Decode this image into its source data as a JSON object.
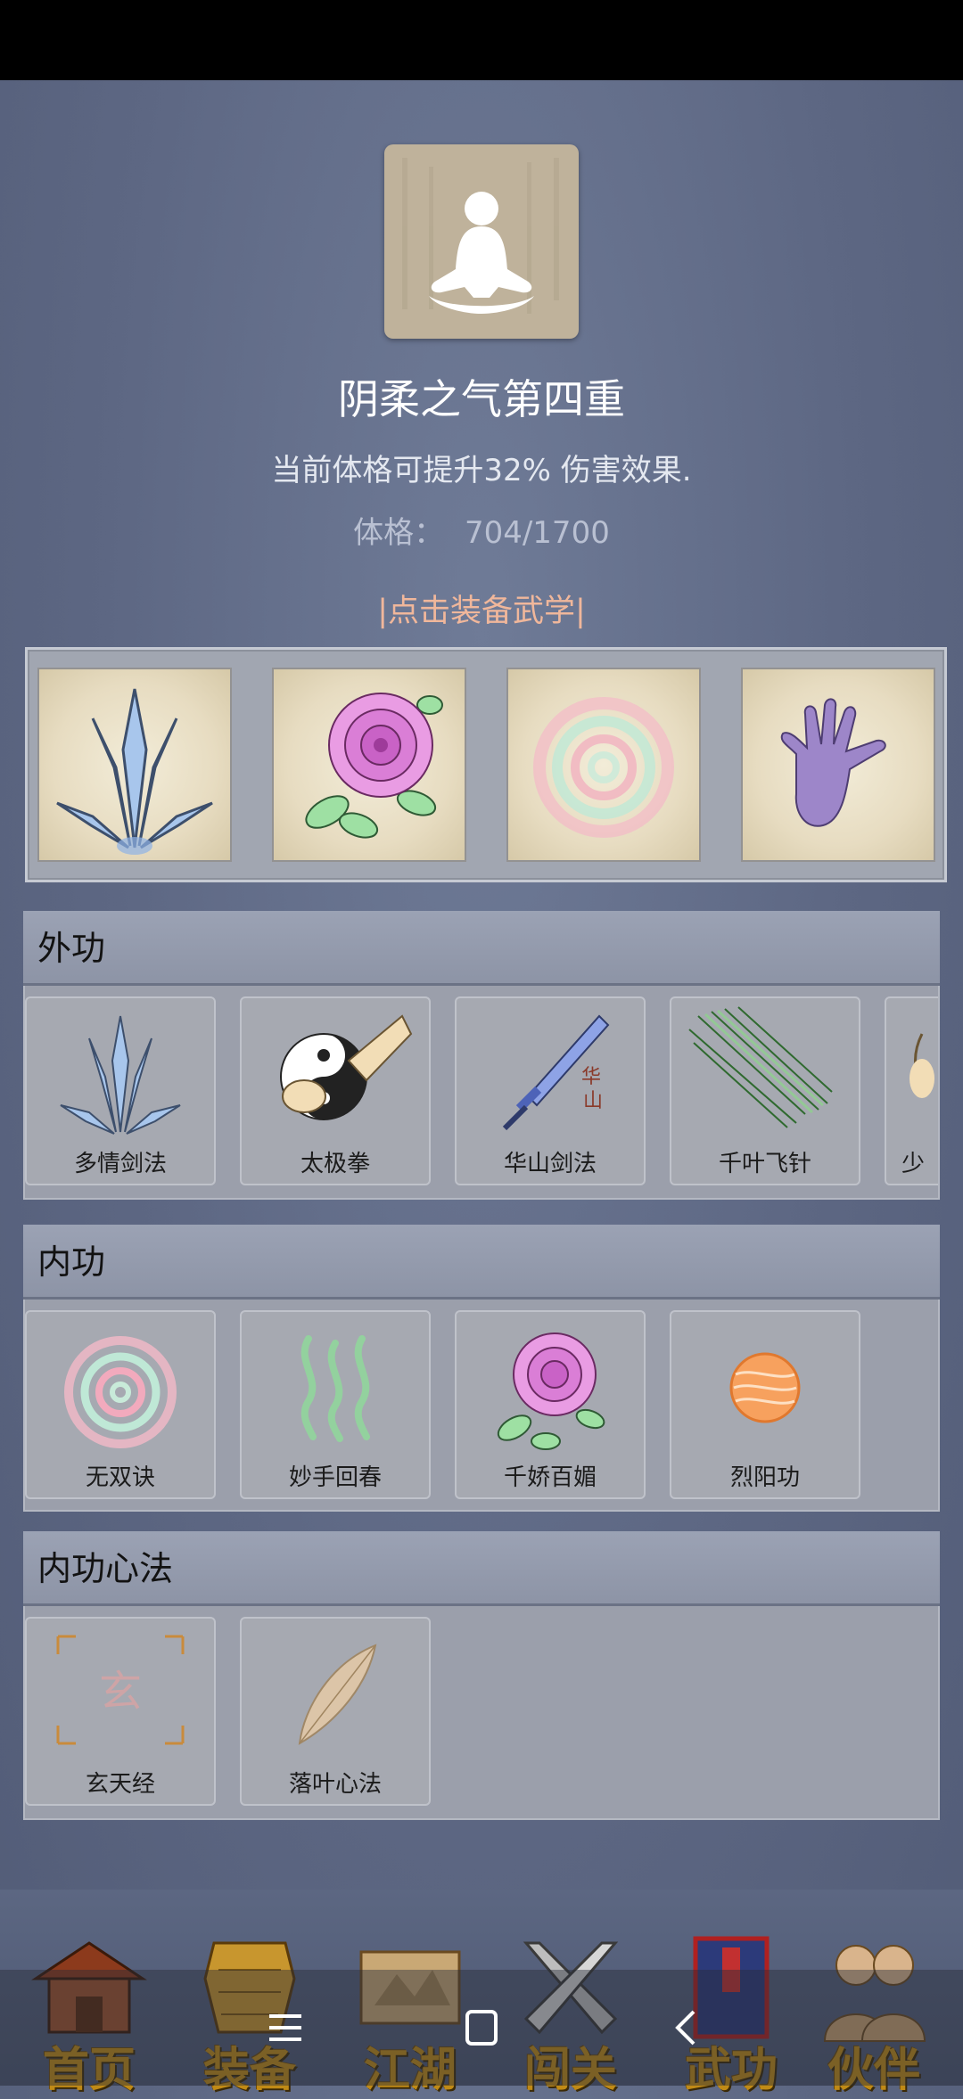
{
  "header": {
    "title": "阴柔之气第四重",
    "description": "当前体格可提升32% 伤害效果.",
    "stat_label": "体格：",
    "stat_value": "704/1700",
    "equip_link": "|点击装备武学|"
  },
  "equipped_slots": [
    {
      "icon": "blue-swords-icon"
    },
    {
      "icon": "pink-rose-icon"
    },
    {
      "icon": "spiral-icon"
    },
    {
      "icon": "purple-palm-icon"
    }
  ],
  "sections": {
    "waigong": {
      "title": "外功",
      "items": [
        {
          "name": "多情剑法",
          "icon": "blue-swords-icon"
        },
        {
          "name": "太极拳",
          "icon": "taiji-fist-icon"
        },
        {
          "name": "华山剑法",
          "icon": "huashan-sword-icon"
        },
        {
          "name": "千叶飞针",
          "icon": "flying-needles-icon"
        },
        {
          "name": "少",
          "icon": "hand-icon"
        }
      ]
    },
    "neigong": {
      "title": "内功",
      "items": [
        {
          "name": "无双诀",
          "icon": "spiral-icon"
        },
        {
          "name": "妙手回春",
          "icon": "healing-waves-icon"
        },
        {
          "name": "千娇百媚",
          "icon": "pink-rose-icon"
        },
        {
          "name": "烈阳功",
          "icon": "sun-orb-icon"
        }
      ]
    },
    "xinfa": {
      "title": "内功心法",
      "items": [
        {
          "name": "玄天经",
          "icon": "xuan-seal-icon",
          "seal_char": "玄"
        },
        {
          "name": "落叶心法",
          "icon": "leaf-icon"
        }
      ]
    }
  },
  "bottom_nav": [
    {
      "label": "首页",
      "icon": "temple-icon"
    },
    {
      "label": "装备",
      "icon": "armor-icon"
    },
    {
      "label": "江湖",
      "icon": "scroll-map-icon"
    },
    {
      "label": "闯关",
      "icon": "crossed-swords-icon"
    },
    {
      "label": "武功",
      "icon": "book-icon"
    },
    {
      "label": "伙伴",
      "icon": "companions-icon"
    }
  ],
  "colors": {
    "background": "#5d6783",
    "equip_link": "#f0b79b",
    "nav_text": "#c08a16"
  }
}
